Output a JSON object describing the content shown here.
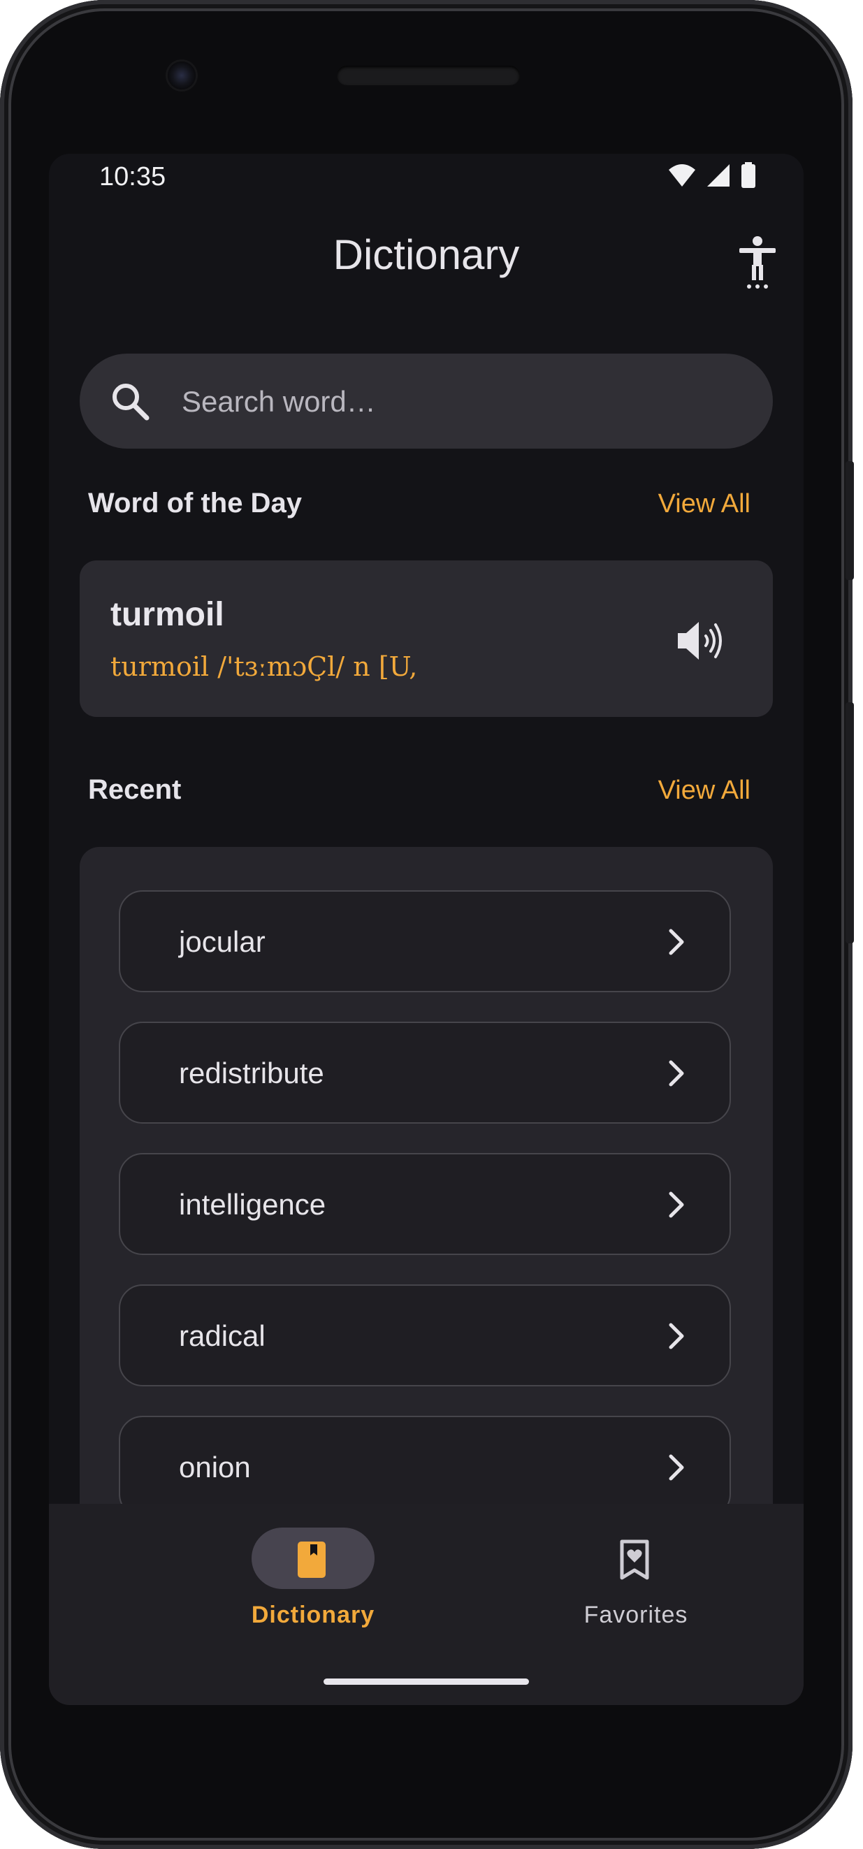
{
  "status_bar": {
    "time": "10:35",
    "icons": [
      "wifi-icon",
      "signal-icon",
      "battery-icon"
    ]
  },
  "header": {
    "title": "Dictionary",
    "action_icon": "accessibility-icon"
  },
  "search": {
    "placeholder": "Search word…",
    "value": "",
    "icon": "search-icon"
  },
  "word_of_the_day": {
    "section_title": "Word of the Day",
    "view_all_label": "View All",
    "word": "turmoil",
    "definition": "turmoil /'tɜːmɔÇl/ n [U,",
    "icon": "speaker-icon"
  },
  "recent": {
    "section_title": "Recent",
    "view_all_label": "View All",
    "items": [
      {
        "label": "jocular"
      },
      {
        "label": "redistribute"
      },
      {
        "label": "intelligence"
      },
      {
        "label": "radical"
      },
      {
        "label": "onion"
      }
    ]
  },
  "bottom_nav": {
    "items": [
      {
        "label": "Dictionary",
        "icon": "book-icon",
        "active": true
      },
      {
        "label": "Favorites",
        "icon": "bookmark-heart-icon",
        "active": false
      }
    ]
  },
  "colors": {
    "accent": "#f2a93b",
    "background": "#131317",
    "surface": "#2b2a30",
    "active_pill": "#47444f"
  }
}
